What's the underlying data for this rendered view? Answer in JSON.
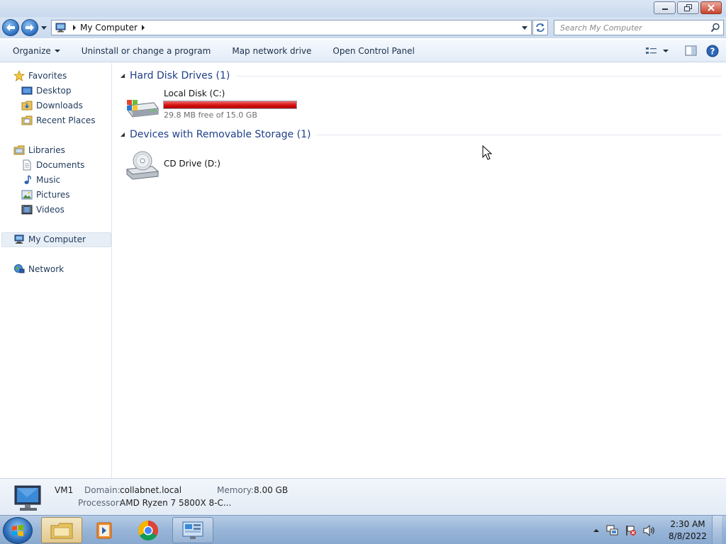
{
  "window": {
    "minimize_icon": "minimize-icon",
    "restore_icon": "restore-icon",
    "close_icon": "close-icon"
  },
  "address_bar": {
    "path": "My Computer",
    "search_placeholder": "Search My Computer"
  },
  "toolbar": {
    "organize": "Organize",
    "uninstall": "Uninstall or change a program",
    "map_drive": "Map network drive",
    "control_panel": "Open Control Panel"
  },
  "nav": {
    "favorites": "Favorites",
    "desktop": "Desktop",
    "downloads": "Downloads",
    "recent_places": "Recent Places",
    "libraries": "Libraries",
    "documents": "Documents",
    "music": "Music",
    "pictures": "Pictures",
    "videos": "Videos",
    "my_computer": "My Computer",
    "network": "Network"
  },
  "groups": {
    "hdd_title": "Hard Disk Drives (1)",
    "removable_title": "Devices with Removable Storage (1)"
  },
  "drives": {
    "c_label": "Local Disk (C:)",
    "c_free": "29.8 MB free of 15.0 GB",
    "c_used_fraction": 0.998,
    "d_label": "CD Drive (D:)"
  },
  "details": {
    "name": "VM1",
    "domain_label": "Domain:",
    "domain_value": "collabnet.local",
    "memory_label": "Memory:",
    "memory_value": "8.00 GB",
    "processor_label": "Processor:",
    "processor_value": "AMD Ryzen 7 5800X 8-C..."
  },
  "taskbar": {
    "time": "2:30 AM",
    "date": "8/8/2022"
  },
  "colors": {
    "disk_full": "#d41010",
    "group_title": "#1e3f8a",
    "nav_text": "#1e395b"
  }
}
